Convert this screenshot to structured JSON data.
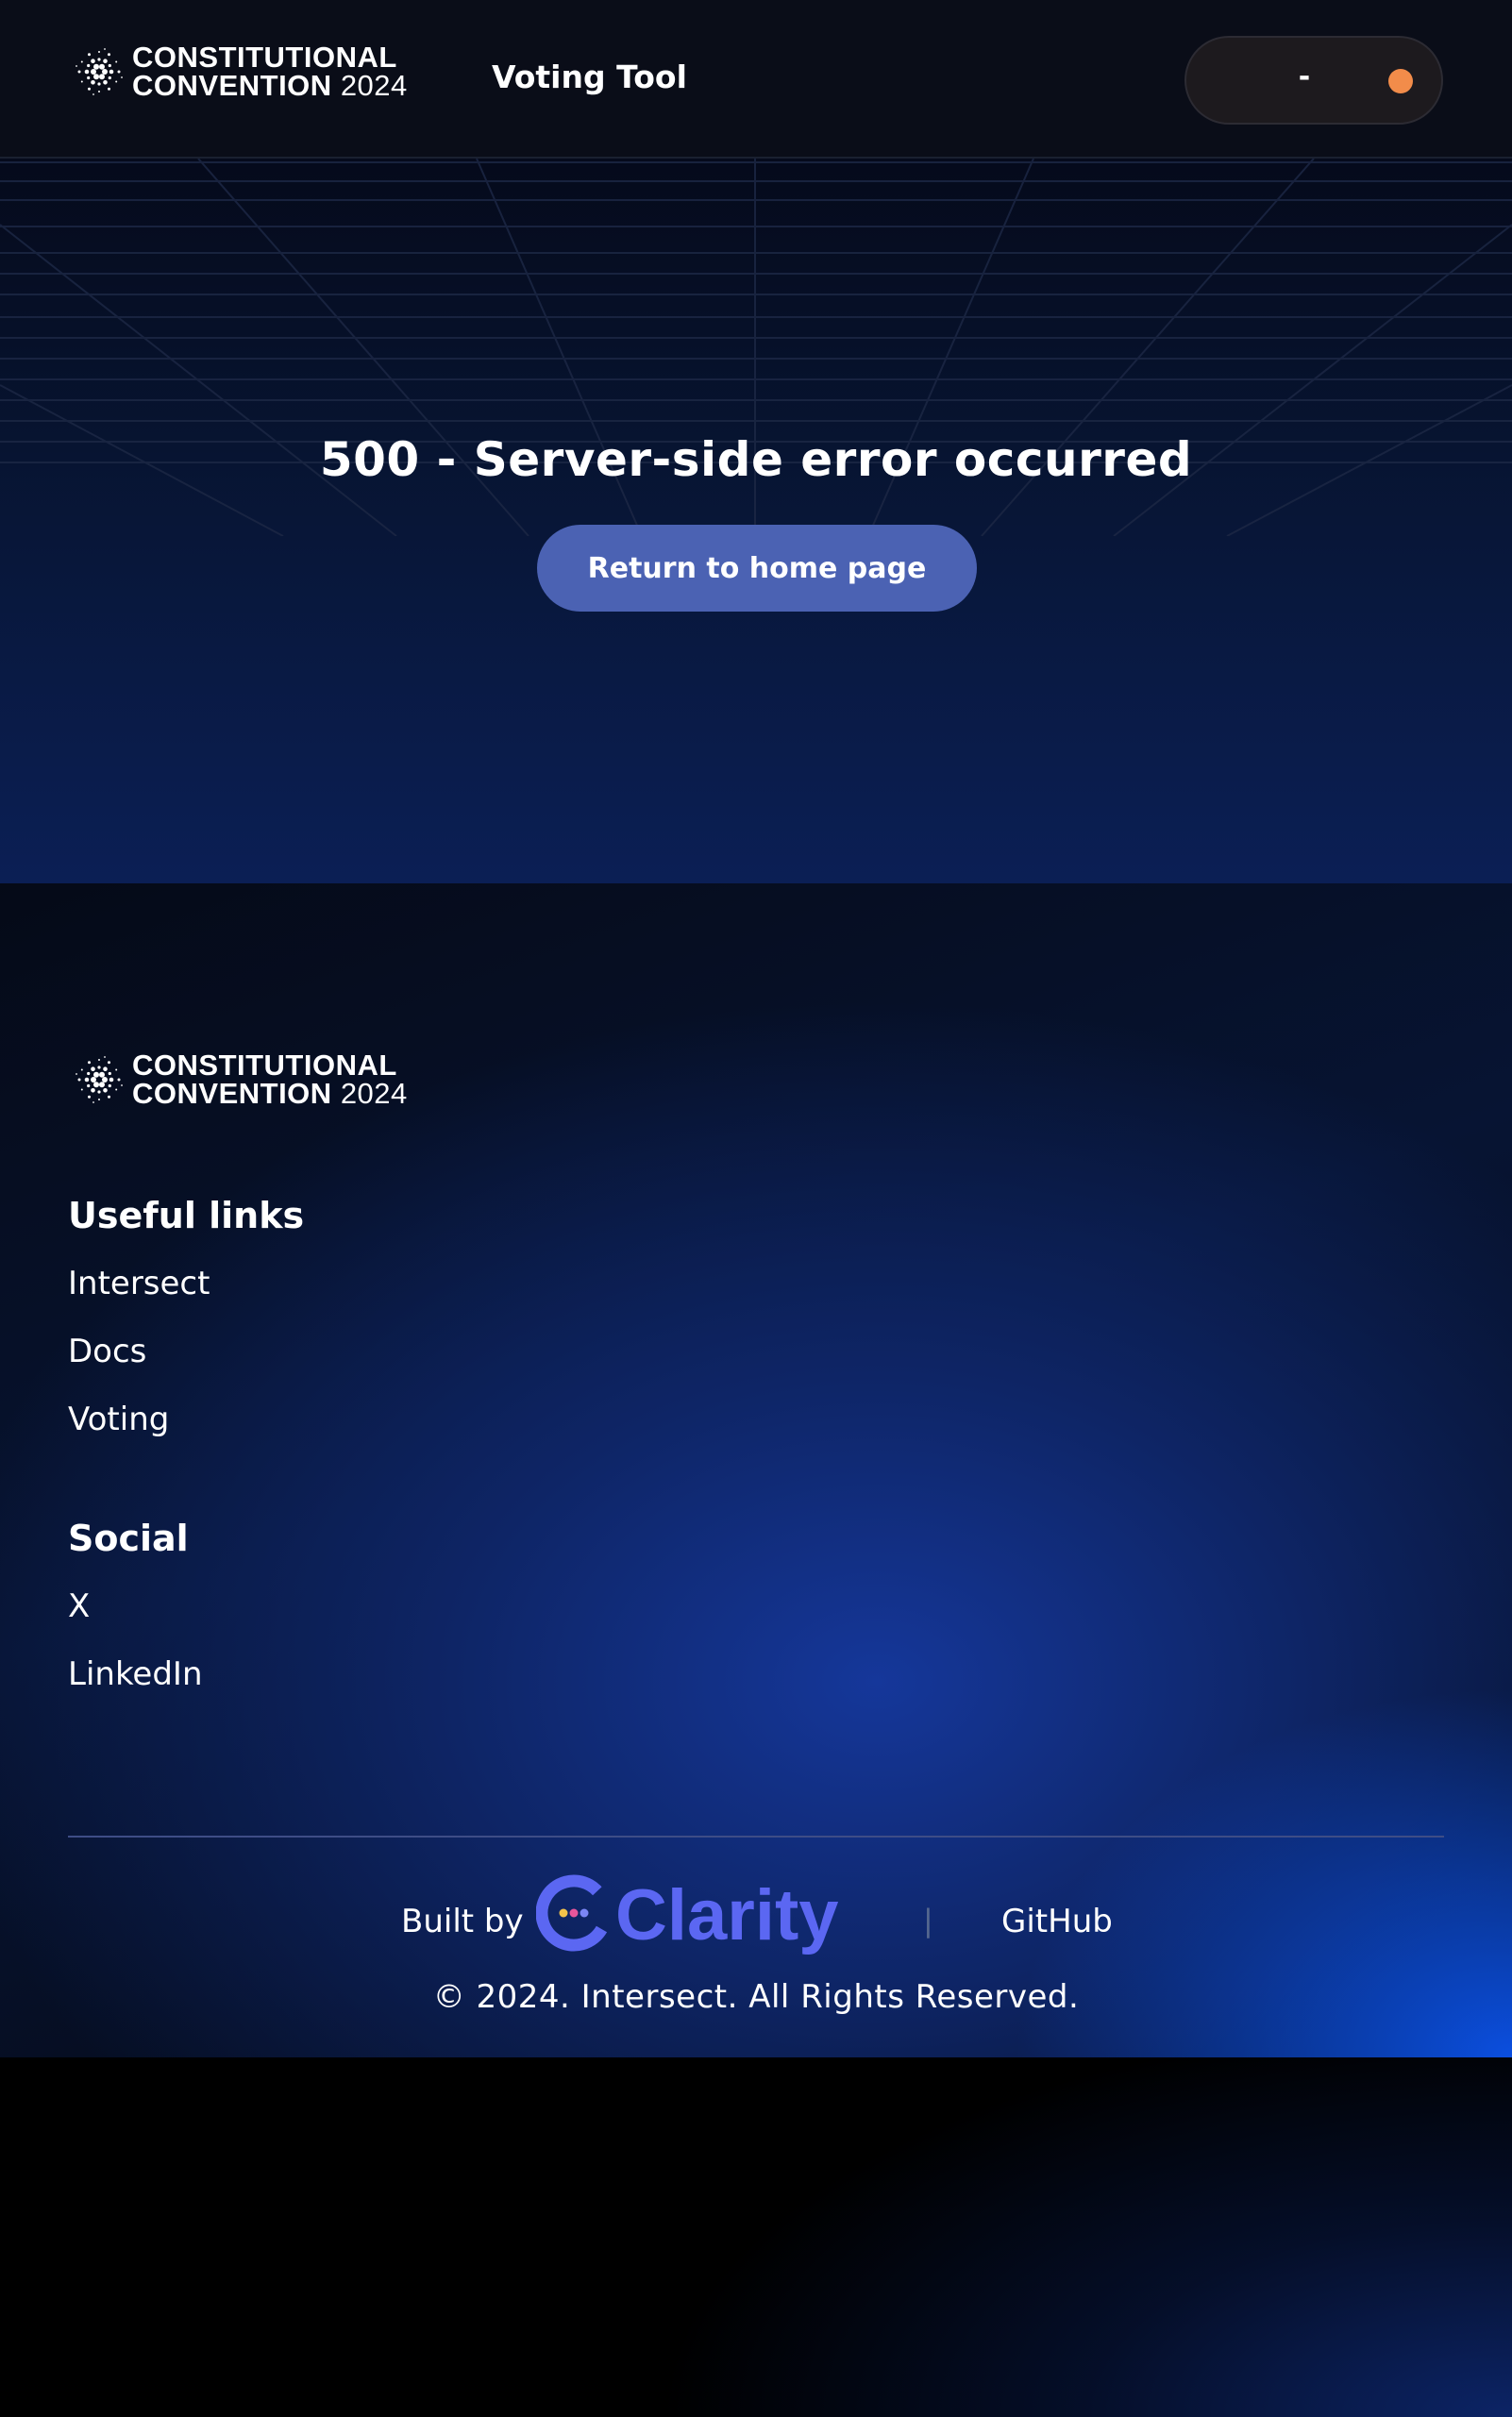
{
  "brand": {
    "line1": "CONSTITUTIONAL",
    "line2": "CONVENTION",
    "year": "2024"
  },
  "header": {
    "nav_label": "Voting Tool",
    "wallet_value": "-",
    "status_color": "#f28c4a"
  },
  "hero": {
    "error_message": "500 - Server-side error occurred",
    "home_button_label": "Return to home page"
  },
  "footer": {
    "useful_links_title": "Useful links",
    "useful_links": [
      "Intersect",
      "Docs",
      "Voting"
    ],
    "social_title": "Social",
    "social_links": [
      "X",
      "LinkedIn"
    ],
    "built_by_label": "Built by",
    "builder_logo_text": "Clarity",
    "separator": "|",
    "github_label": "GitHub",
    "copyright": "© 2024. Intersect. All Rights Reserved."
  },
  "colors": {
    "accent_button": "#4b62b3",
    "clarity_brand": "#5b67f2",
    "header_bg": "#0a0d18"
  },
  "icons": [
    "cardano-logo-icon",
    "clarity-logo-icon",
    "status-dot-icon"
  ]
}
